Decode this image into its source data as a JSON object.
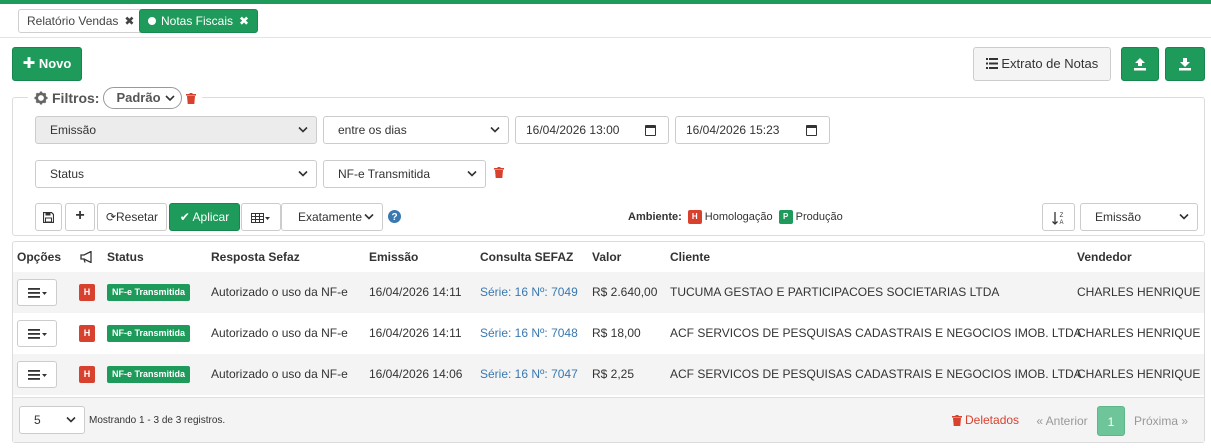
{
  "tabs": [
    {
      "label": "Relatório Vendas",
      "active": false
    },
    {
      "label": "Notas Fiscais",
      "active": true
    }
  ],
  "toolbar": {
    "novo_label": "Novo",
    "extrato_label": "Extrato de Notas"
  },
  "filters": {
    "title": "Filtros:",
    "preset": "Padrão",
    "row1": {
      "field": "Emissão",
      "operator": "entre os dias",
      "date_from": "16/04/2026 13:00",
      "date_to": "16/04/2026 15:23"
    },
    "row2": {
      "field": "Status",
      "value": "NF-e Transmitida"
    },
    "reset_label": "Resetar",
    "apply_label": "Aplicar",
    "match_mode": "Exatamente",
    "ambiente_label": "Ambiente:",
    "homologacao_badge": "H",
    "homologacao_label": "Homologação",
    "producao_badge": "P",
    "producao_label": "Produção",
    "sort_field": "Emissão"
  },
  "table": {
    "columns": [
      "Opções",
      "Status",
      "Resposta Sefaz",
      "Emissão",
      "Consulta SEFAZ",
      "Valor",
      "Cliente",
      "Vendedor"
    ],
    "rows": [
      {
        "env_badge": "H",
        "status": "NF-e Transmitida",
        "resposta": "Autorizado o uso da NF-e",
        "emissao": "16/04/2026 14:11",
        "consulta": "Série: 16 Nº: 7049",
        "valor": "R$ 2.640,00",
        "cliente": "TUCUMA GESTAO E PARTICIPACOES SOCIETARIAS LTDA",
        "vendedor": "CHARLES HENRIQUE"
      },
      {
        "env_badge": "H",
        "status": "NF-e Transmitida",
        "resposta": "Autorizado o uso da NF-e",
        "emissao": "16/04/2026 14:11",
        "consulta": "Série: 16 Nº: 7048",
        "valor": "R$ 18,00",
        "cliente": "ACF SERVICOS DE PESQUISAS CADASTRAIS E NEGOCIOS IMOB. LTDA",
        "vendedor": "CHARLES HENRIQUE"
      },
      {
        "env_badge": "H",
        "status": "NF-e Transmitida",
        "resposta": "Autorizado o uso da NF-e",
        "emissao": "16/04/2026 14:06",
        "consulta": "Série: 16 Nº: 7047",
        "valor": "R$ 2,25",
        "cliente": "ACF SERVICOS DE PESQUISAS CADASTRAIS E NEGOCIOS IMOB. LTDA",
        "vendedor": "CHARLES HENRIQUE"
      }
    ]
  },
  "pagination": {
    "page_size": "5",
    "showing": "Mostrando 1 - 3 de 3 registros.",
    "deleted_label": "Deletados",
    "prev_label": "« Anterior",
    "current_page": "1",
    "next_label": "Próxima »"
  },
  "colors": {
    "brand_green": "#1e9a5a",
    "danger_red": "#d9412f",
    "link_blue": "#3a78b0"
  }
}
